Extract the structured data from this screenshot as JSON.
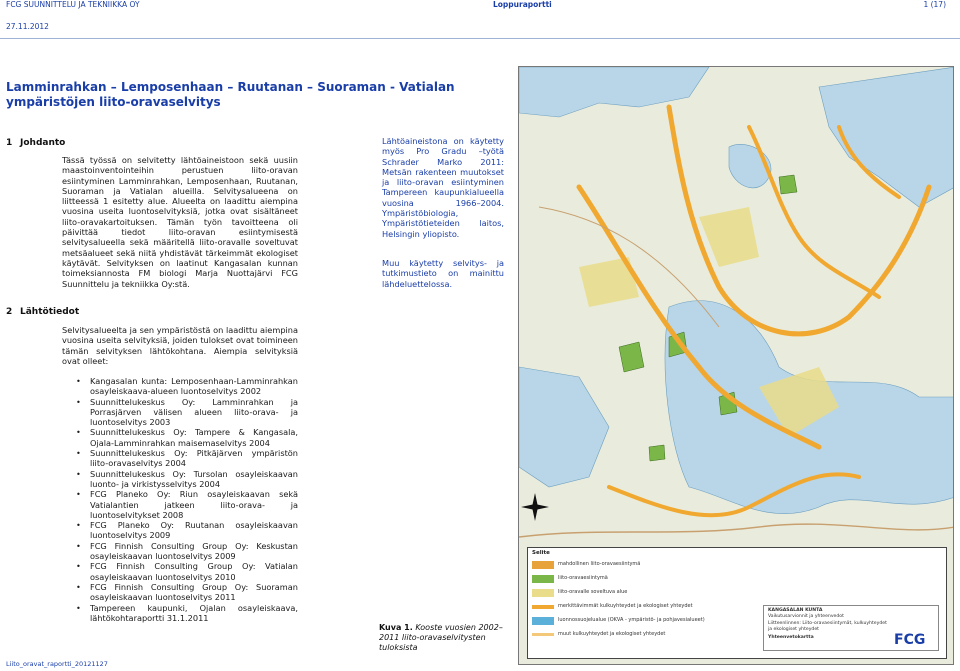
{
  "header": {
    "company": "FCG SUUNNITTELU JA TEKNIIKKA OY",
    "report_type": "Loppuraportti",
    "page": "1 (17)",
    "date": "27.11.2012"
  },
  "document": {
    "title": "Lamminrahkan – Lemposenhaan – Ruutanan – Suoraman - Vatialan ympäristöjen liito-oravaselvitys",
    "section1": {
      "number": "1",
      "heading": "Johdanto"
    },
    "section1_para": "Tässä työssä on selvitetty lähtöaineistoon sekä uusiin maastoinventointeihin perustuen liito-oravan esiintyminen Lamminrahkan, Lemposenhaan, Ruutanan, Suoraman ja Vatialan alueilla. Selvitysalueena on liitteessä 1 esitetty alue. Alueelta on laadittu aiempina vuosina useita luontoselvityksiä, jotka ovat sisältäneet liito-oravakartoituksen. Tämän työn tavoitteena oli päivittää tiedot liito-oravan esiintymisestä selvitysalueella sekä määritellä liito-oravalle soveltuvat metsäalueet sekä niitä yhdistävät tärkeimmät ekologiset käytävät. Selvityksen on laatinut Kangasalan kunnan toimeksiannosta FM biologi Marja Nuottajärvi FCG Suunnittelu ja tekniikka Oy:stä.",
    "section2": {
      "number": "2",
      "heading": "Lähtötiedot"
    },
    "section2_para": "Selvitysalueelta ja sen ympäristöstä on laadittu aiempina vuosina useita selvityksiä, joiden tulokset ovat toimineen tämän selvityksen lähtökohtana. Aiempia selvityksiä ovat olleet:",
    "references": [
      "Kangasalan kunta: Lemposenhaan-Lamminrahkan osayleiskaava-alueen luontoselvitys 2002",
      "Suunnittelukeskus Oy: Lamminrahkan ja Porrasjärven välisen alueen liito-orava- ja luontoselvitys 2003",
      "Suunnittelukeskus Oy: Tampere & Kangasala, Ojala-Lamminrahkan maisemaselvitys 2004",
      "Suunnittelukeskus Oy: Pitkäjärven ympäristön liito-oravaselvitys 2004",
      "Suunnittelukeskus Oy: Tursolan osayleiskaavan luonto- ja virkistysselvitys 2004",
      "FCG Planeko Oy: Riun osayleiskaavan sekä Vatialantien jatkeen liito-orava- ja luontoselvitykset 2008",
      "FCG Planeko Oy: Ruutanan osayleiskaavan luontoselvitys 2009",
      "FCG Finnish Consulting Group Oy: Keskustan osayleiskaavan luontoselvitys 2009",
      "FCG Finnish Consulting Group Oy: Vatialan osayleiskaavan luontoselvitys 2010",
      "FCG Finnish Consulting Group Oy: Suoraman osayleiskaavan luontoselvitys 2011",
      "Tampereen kaupunki, Ojalan osayleiskaava, lähtökohtaraportti 31.1.2011"
    ],
    "side_note_1": "Lähtöaineistona on käytetty myös Pro Gradu –työtä Schrader Marko 2011: Metsän rakenteen muutokset ja liito-oravan esiintyminen Tampereen kaupunkialueella vuosina 1966–2004. Ympäristöbiologia, Ympäristötieteiden laitos, Helsingin yliopisto.",
    "side_note_2": "Muu käytetty selvitys- ja tutkimustieto on mainittu lähdeluettelossa.",
    "caption_label": "Kuva 1.",
    "caption_text": "Kooste vuosien 2002–2011 liito-oravaselvitysten tuloksista",
    "footer": "Liito_oravat_raportti_20121127"
  },
  "map": {
    "legend_title": "Selite",
    "legend_items": [
      {
        "label": "mahdollinen liito-oravaesiintymä",
        "color": "#e8a23a"
      },
      {
        "label": "liito-oravaesiintymä",
        "color": "#7ab648"
      },
      {
        "label": "liito-oravalle soveltuva alue",
        "color": "#e9dc8a"
      },
      {
        "label": "merkittävimmät kulkuyhteydet ja ekologiset yhteydet",
        "color": "#f0a830"
      },
      {
        "label": "luonnossuojelualue (OKVA - ympäristö- ja pohjavesialueet)",
        "color": "#5ab0d8"
      },
      {
        "label": "muut kulkuyhteydet ja ekologiset yhteydet",
        "color": "#f3c878"
      }
    ],
    "info_lines": [
      "KANGASALAN KUNTA",
      "Vaikutusarvionnit ja yhteenvedot",
      "Liitteenlinnen: Liito-oravaesiintymät, kulkuyhteydet",
      "ja ekologiset yhteydet",
      "Yhteenvetokartta"
    ],
    "logo": "FCG",
    "colors": {
      "water": "#b9d6e8",
      "forest": "#e7ecd8",
      "corridor": "#f0a830",
      "occurrence": "#7ab648",
      "habitat": "#e9dc8a"
    }
  }
}
